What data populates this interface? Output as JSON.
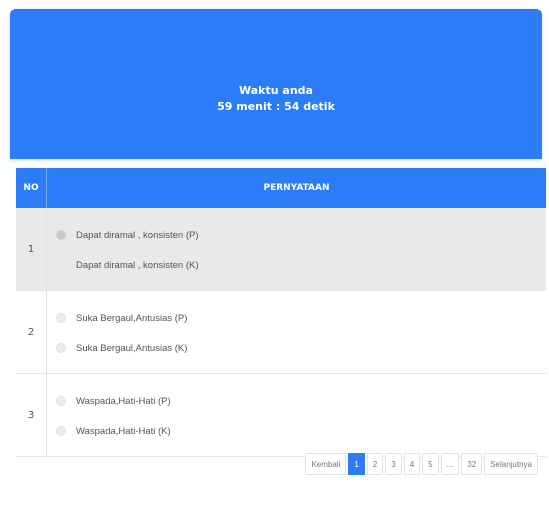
{
  "timer": {
    "label": "Waktu anda",
    "remaining": "59 menit : 54 detik"
  },
  "table": {
    "headers": {
      "no": "NO",
      "statement": "PERNYATAAN"
    },
    "rows": [
      {
        "no": "1",
        "options": [
          "Dapat diramal , konsisten (P)",
          "Dapat diramal , konsisten (K)"
        ]
      },
      {
        "no": "2",
        "options": [
          "Suka Bergaul,Antusias (P)",
          "Suka Bergaul,Antusias (K)"
        ]
      },
      {
        "no": "3",
        "options": [
          "Waspada,Hati-Hati (P)",
          "Waspada,Hati-Hati (K)"
        ]
      }
    ]
  },
  "pagination": {
    "prev": "Kembali",
    "pages": [
      "1",
      "2",
      "3",
      "4",
      "5",
      "...",
      "32"
    ],
    "current": "1",
    "next": "Selanjutnya"
  },
  "colors": {
    "accent": "#2b7cf6",
    "row_shaded": "#e9e9e9"
  }
}
